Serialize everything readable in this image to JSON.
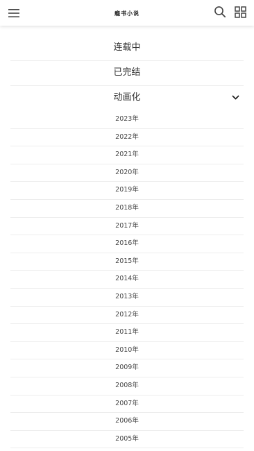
{
  "header": {
    "menu_icon": "hamburger-menu-icon",
    "logo_text": "瘾书小说",
    "search_icon": "search-icon",
    "grid_icon": "grid-apps-icon"
  },
  "categories": [
    {
      "label": "连载中"
    },
    {
      "label": "已完结"
    },
    {
      "label": "动画化",
      "expanded": true,
      "icon": "chevron-down-icon"
    }
  ],
  "years": [
    "2023年",
    "2022年",
    "2021年",
    "2020年",
    "2019年",
    "2018年",
    "2017年",
    "2016年",
    "2015年",
    "2014年",
    "2013年",
    "2012年",
    "2011年",
    "2010年",
    "2009年",
    "2008年",
    "2007年",
    "2006年",
    "2005年"
  ],
  "colors": {
    "text": "#333333",
    "divider": "#ececec",
    "background": "#ffffff",
    "icon": "#444444"
  }
}
